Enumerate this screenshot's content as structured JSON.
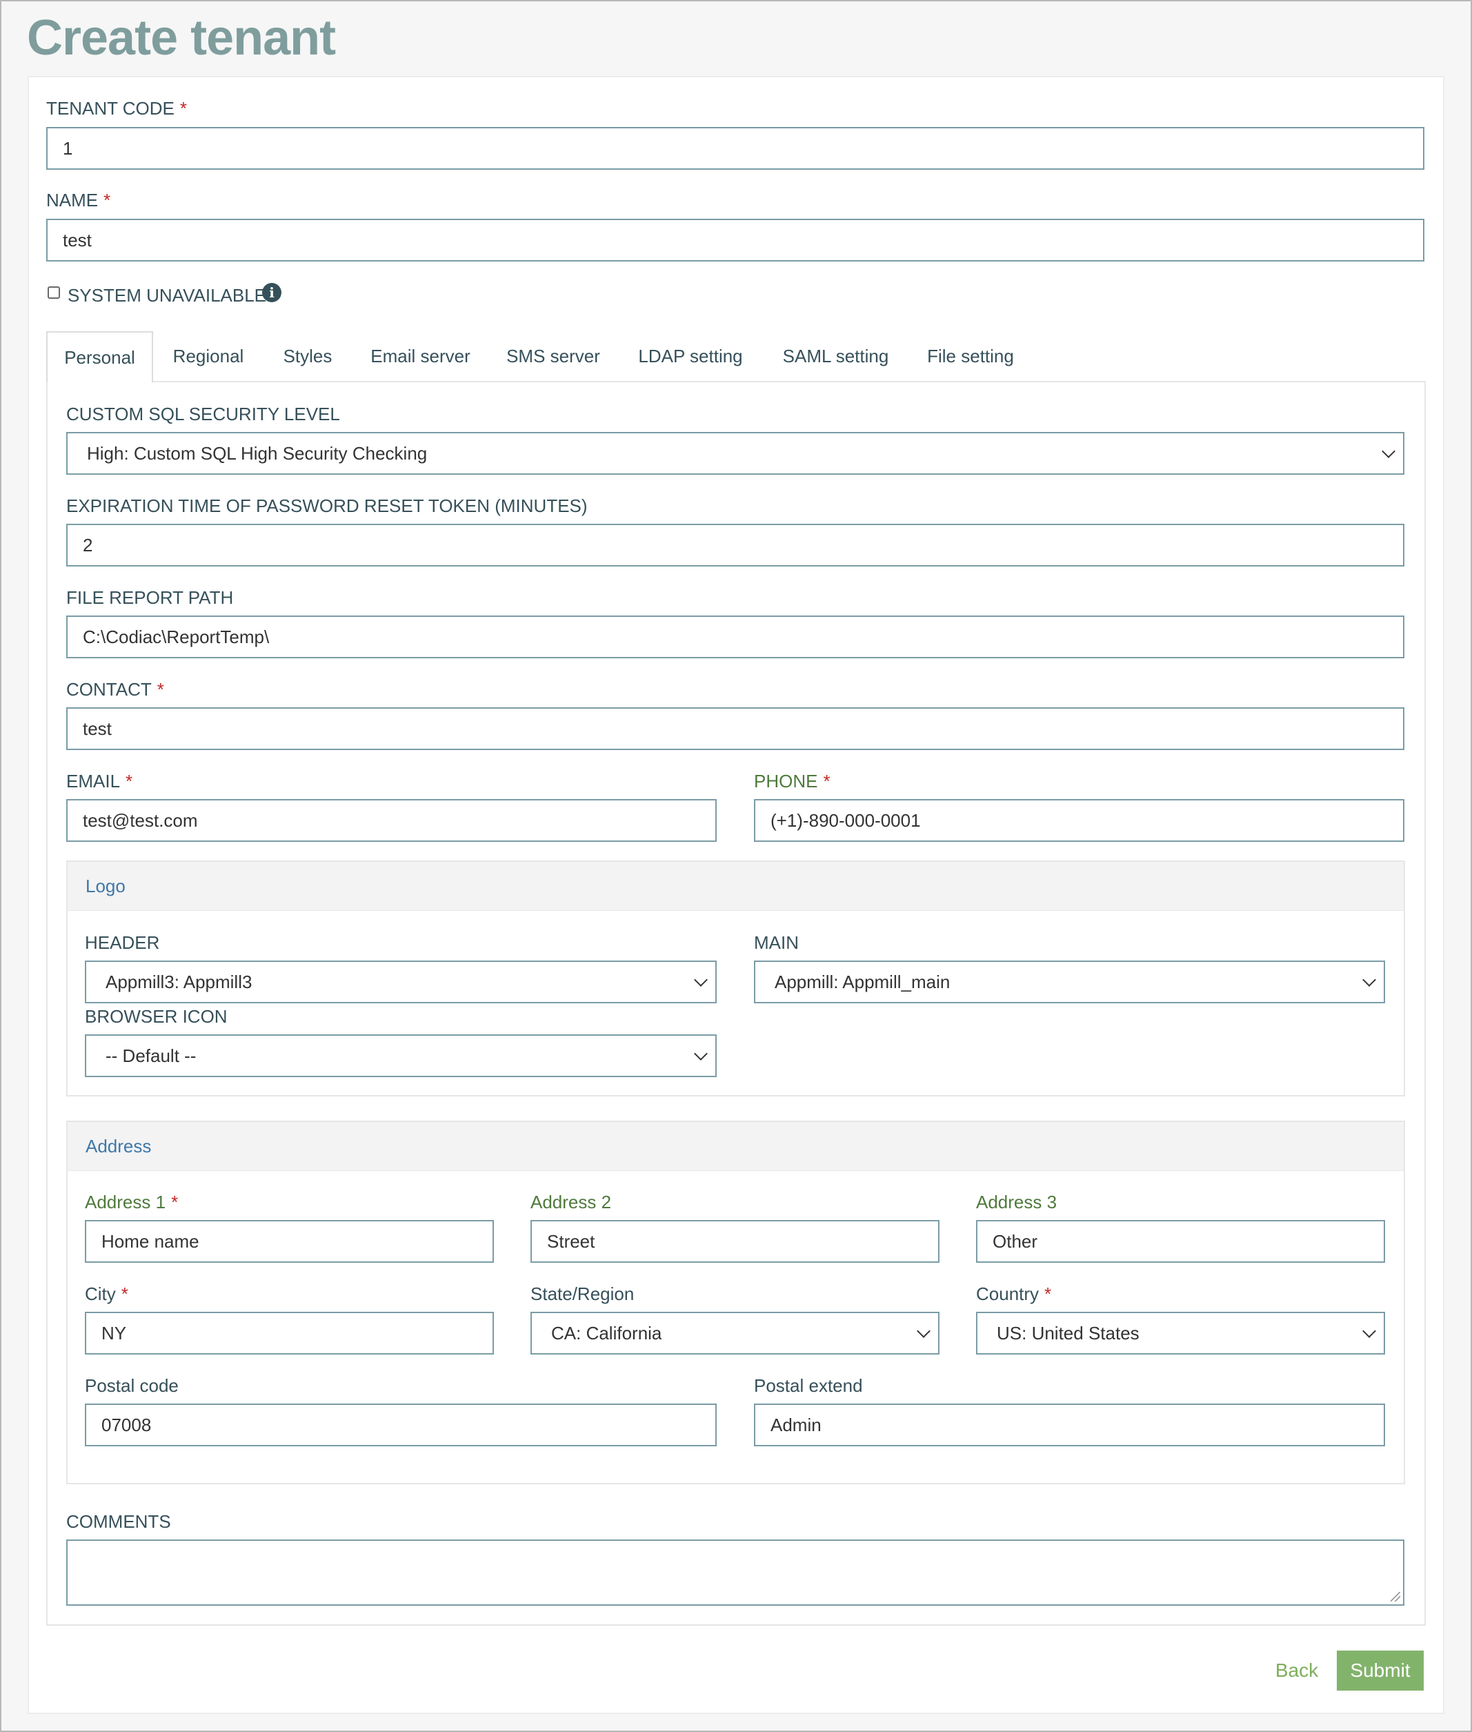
{
  "page": {
    "title": "Create tenant"
  },
  "tenant_code": {
    "label": "TENANT CODE",
    "required_mark": "*",
    "value": "1"
  },
  "name": {
    "label": "NAME",
    "required_mark": "*",
    "value": "test"
  },
  "system_unavailable": {
    "label": "SYSTEM UNAVAILABLE",
    "checked": false,
    "info_icon": "info-icon"
  },
  "tabs": [
    {
      "label": "Personal",
      "active": true
    },
    {
      "label": "Regional"
    },
    {
      "label": "Styles"
    },
    {
      "label": "Email server"
    },
    {
      "label": "SMS server"
    },
    {
      "label": "LDAP setting"
    },
    {
      "label": "SAML setting"
    },
    {
      "label": "File setting"
    }
  ],
  "personal": {
    "sql_security": {
      "label": "CUSTOM SQL SECURITY LEVEL",
      "value": "High: Custom SQL High Security Checking"
    },
    "expiration": {
      "label": "EXPIRATION TIME OF PASSWORD RESET TOKEN (MINUTES)",
      "value": "2"
    },
    "file_report_path": {
      "label": "FILE REPORT PATH",
      "value": "C:\\Codiac\\ReportTemp\\"
    },
    "contact": {
      "label": "CONTACT",
      "required_mark": "*",
      "value": "test"
    },
    "email": {
      "label": "EMAIL",
      "required_mark": "*",
      "value": "test@test.com"
    },
    "phone": {
      "label": "PHONE",
      "required_mark": "*",
      "value": "(+1)-890-000-0001"
    },
    "logo": {
      "title": "Logo",
      "header": {
        "label": "HEADER",
        "value": "Appmill3: Appmill3"
      },
      "main": {
        "label": "MAIN",
        "value": "Appmill: Appmill_main"
      },
      "browser_icon": {
        "label": "BROWSER ICON",
        "value": "-- Default --"
      }
    },
    "address": {
      "title": "Address",
      "address1": {
        "label": "Address 1",
        "required_mark": "*",
        "value": "Home name"
      },
      "address2": {
        "label": "Address 2",
        "value": "Street"
      },
      "address3": {
        "label": "Address 3",
        "value": "Other"
      },
      "city": {
        "label": "City",
        "required_mark": "*",
        "value": "NY"
      },
      "state": {
        "label": "State/Region",
        "value": "CA: California"
      },
      "country": {
        "label": "Country",
        "required_mark": "*",
        "value": "US: United States"
      },
      "postal_code": {
        "label": "Postal code",
        "value": "07008"
      },
      "postal_extend": {
        "label": "Postal extend",
        "value": "Admin"
      }
    },
    "comments": {
      "label": "COMMENTS",
      "value": ""
    }
  },
  "actions": {
    "back_label": "Back",
    "submit_label": "Submit"
  },
  "colors": {
    "title": "#7f9d9d",
    "label": "#36505a",
    "accent_green": "#82b36b",
    "required": "#c62828",
    "panel_title": "#3f78a8"
  }
}
